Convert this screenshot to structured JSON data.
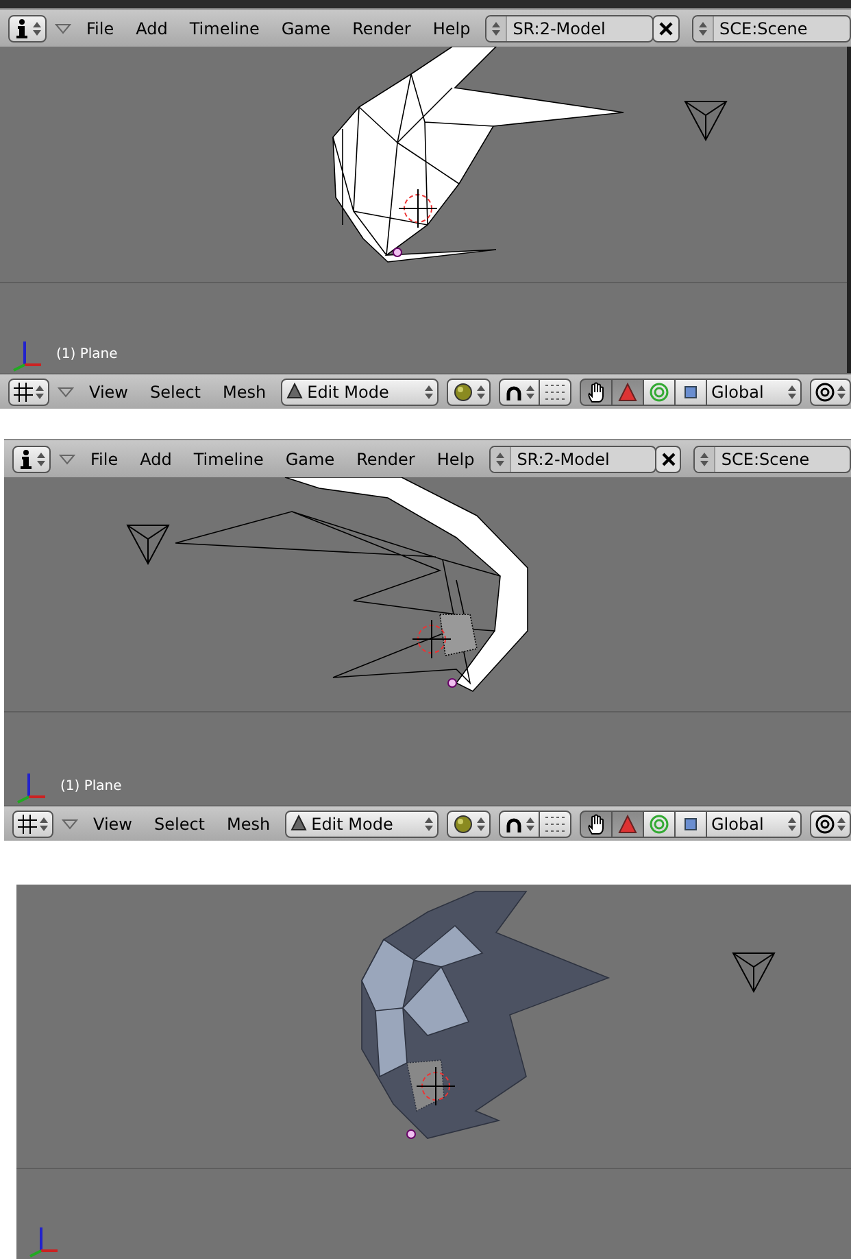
{
  "panels": [
    {
      "kind": "titled",
      "header": {
        "menus": [
          "File",
          "Add",
          "Timeline",
          "Game",
          "Render",
          "Help"
        ],
        "screen": "SR:2-Model",
        "scene": "SCE:Scene"
      },
      "viewport": {
        "kind": "wireframe_front",
        "object_label": "(1) Plane"
      },
      "toolbar": {
        "menus": [
          "View",
          "Select",
          "Mesh"
        ],
        "mode": "Edit Mode",
        "manipulators": [
          {
            "kind": "hand",
            "selected": true
          },
          {
            "kind": "translate",
            "selected": true
          },
          {
            "kind": "rotate",
            "selected": false
          },
          {
            "kind": "scale",
            "selected": false
          }
        ],
        "orientation": "Global"
      }
    },
    {
      "kind": "plain",
      "header": {
        "menus": [
          "File",
          "Add",
          "Timeline",
          "Game",
          "Render",
          "Help"
        ],
        "screen": "SR:2-Model",
        "scene": "SCE:Scene"
      },
      "viewport": {
        "kind": "wireframe_side",
        "object_label": "(1) Plane"
      },
      "toolbar": {
        "menus": [
          "View",
          "Select",
          "Mesh"
        ],
        "mode": "Edit Mode",
        "manipulators": [
          {
            "kind": "hand",
            "selected": true
          },
          {
            "kind": "translate",
            "selected": true
          },
          {
            "kind": "rotate",
            "selected": false
          },
          {
            "kind": "scale",
            "selected": false
          }
        ],
        "orientation": "Global"
      }
    },
    {
      "kind": "inset",
      "viewport": {
        "kind": "solid_front"
      }
    }
  ]
}
